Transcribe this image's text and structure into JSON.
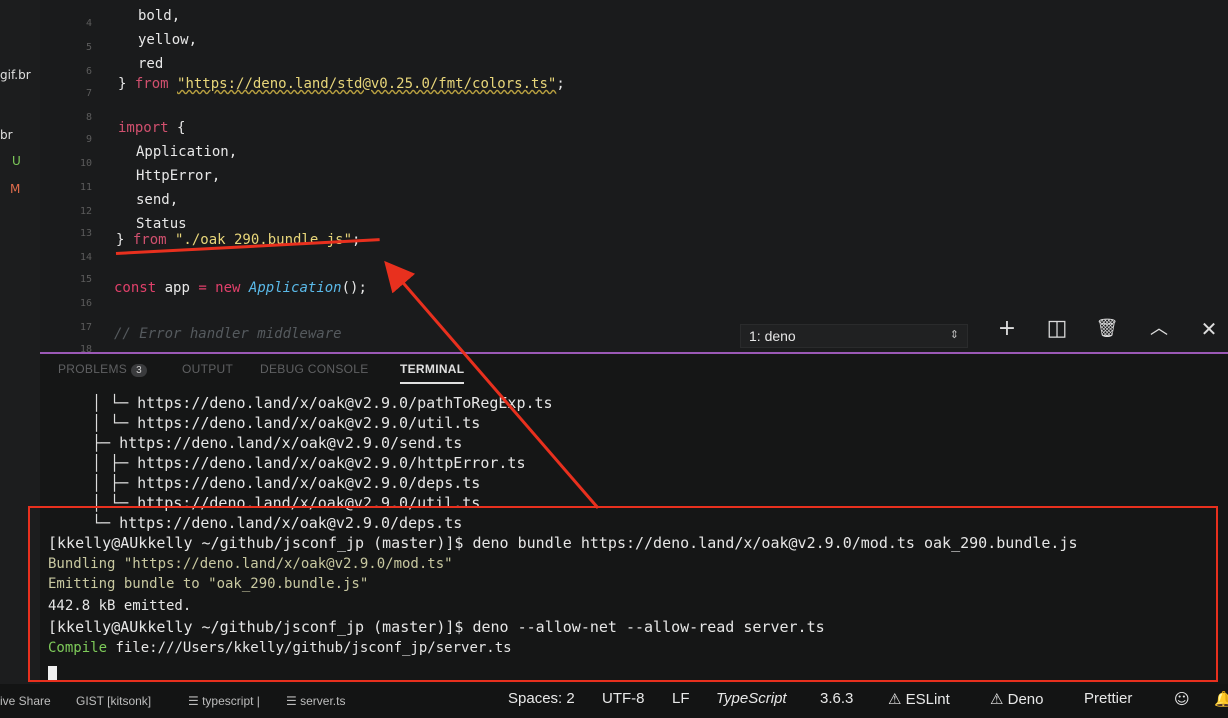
{
  "explorer": {
    "items": [
      {
        "label": "gif.br",
        "color": "#e0e0e0"
      },
      {
        "label": "br",
        "color": "#e0e0e0"
      },
      {
        "label": "U",
        "color": "#7ecb5a"
      },
      {
        "label": "M",
        "color": "#e06c4c"
      }
    ]
  },
  "editor": {
    "line_numbers": [
      "4",
      "5",
      "6",
      "7",
      "8",
      "9",
      "10",
      "11",
      "12",
      "13",
      "14",
      "15",
      "16",
      "17",
      "18"
    ],
    "lines": {
      "l4": "bold,",
      "l5": "yellow,",
      "l6": "red",
      "l7_close": "} ",
      "l7_from": "from",
      "l7_str": "\"https://deno.land/std@v0.25.0/fmt/colors.ts\"",
      "l7_semi": ";",
      "l9_import": "import",
      "l9_brace": " {",
      "l10": "Application,",
      "l11": "HttpError,",
      "l12": "send,",
      "l13": "Status",
      "l14_close": "} ",
      "l14_from": "from",
      "l14_str": " \"./oak_290.bundle.js\"",
      "l14_semi": ";",
      "l16_const": "const",
      "l16_app": " app ",
      "l16_eq": "= ",
      "l16_new": "new ",
      "l16_fn": "Application",
      "l16_end": "();",
      "l18": "// Error handler middleware"
    }
  },
  "panel": {
    "tabs": [
      {
        "label": "PROBLEMS",
        "badge": "3"
      },
      {
        "label": "OUTPUT"
      },
      {
        "label": "DEBUG CONSOLE"
      },
      {
        "label": "TERMINAL"
      }
    ],
    "terminal_select": "1: deno",
    "icons": [
      "plus-icon",
      "split-icon",
      "trash-icon",
      "chevron-up-icon",
      "close-icon"
    ],
    "terminal_lines": {
      "t1": "https://deno.land/x/oak@v2.9.0/pathToRegExp.ts",
      "t2": "https://deno.land/x/oak@v2.9.0/util.ts",
      "t3": "https://deno.land/x/oak@v2.9.0/send.ts",
      "t4": "https://deno.land/x/oak@v2.9.0/httpError.ts",
      "t5": "https://deno.land/x/oak@v2.9.0/deps.ts",
      "t6": "https://deno.land/x/oak@v2.9.0/util.ts",
      "t7": "https://deno.land/x/oak@v2.9.0/deps.ts",
      "t8": "[kkelly@AUkkelly ~/github/jsconf_jp (master)]$ deno bundle https://deno.land/x/oak@v2.9.0/mod.ts oak_290.bundle.js",
      "t9": "Bundling \"https://deno.land/x/oak@v2.9.0/mod.ts\"",
      "t10": "Emitting bundle to \"oak_290.bundle.js\"",
      "t11": "442.8 kB emitted.",
      "t12": "[kkelly@AUkkelly ~/github/jsconf_jp (master)]$ deno --allow-net --allow-read server.ts",
      "t13_compile": "Compile",
      "t13_rest": " file:///Users/kkelly/github/jsconf_jp/server.ts"
    }
  },
  "statusbar": {
    "left": [
      "ive Share",
      "GIST [kitsonk]",
      "typescript |",
      "server.ts"
    ],
    "spaces": "Spaces: 2",
    "encoding": "UTF-8",
    "eol": "LF",
    "language": "TypeScript",
    "version": "3.6.3",
    "eslint": "ESLint",
    "deno": "Deno",
    "prettier": "Prettier"
  },
  "colors": {
    "annotation_red": "#e8301e",
    "panel_accent": "#9b59b6"
  }
}
